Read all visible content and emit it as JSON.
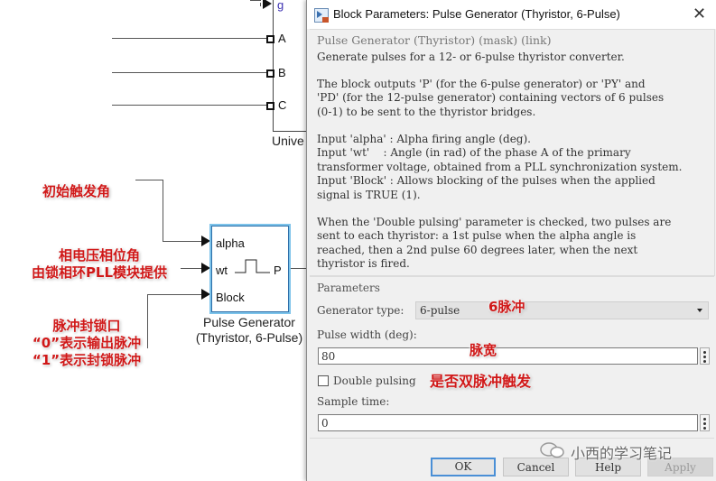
{
  "canvas": {
    "universal_bridge": {
      "ports": [
        "g",
        "A",
        "B",
        "C"
      ],
      "caption_partial": "Unive"
    },
    "pulse_generator": {
      "inputs": [
        "alpha",
        "wt",
        "Block"
      ],
      "output": "P",
      "caption_line1": "Pulse Generator",
      "caption_line2": "(Thyristor, 6-Pulse)"
    },
    "annotations": {
      "alpha": "初始触发角",
      "wt_line1": "相电压相位角",
      "wt_line2": "由锁相环PLL模块提供",
      "block_line1": "脉冲封锁口",
      "block_line2": "“0”表示输出脉冲",
      "block_line3": "“1”表示封锁脉冲",
      "generator_type": "6脉冲",
      "pulse_width": "脉宽",
      "double_pulsing": "是否双脉冲触发"
    },
    "colors": {
      "annotation_red": "#d01818",
      "selected_block_border": "#7cc3ea",
      "port_g_label": "#3a2fb0"
    }
  },
  "dialog": {
    "title": "Block Parameters: Pulse Generator (Thyristor, 6-Pulse)",
    "description_title": "Pulse Generator (Thyristor) (mask) (link)",
    "description": [
      "Generate pulses for a 12- or 6-pulse thyristor converter.",
      "The block outputs 'P' (for the 6-pulse generator) or 'PY' and\n'PD' (for the 12-pulse generator) containing vectors of 6 pulses\n(0-1) to be sent to the thyristor bridges.",
      "Input 'alpha' : Alpha firing angle (deg).\nInput 'wt'    : Angle (in rad) of the phase A of the primary\ntransformer voltage, obtained from a PLL synchronization system.\nInput 'Block' : Allows blocking of the pulses when the applied\nsignal is TRUE (1).",
      "When the 'Double pulsing' parameter is checked, two pulses are\nsent to each thyristor: a 1st pulse when the alpha angle is\nreached, then a 2nd pulse 60 degrees later, when the next\nthyristor is fired."
    ],
    "parameters_title": "Parameters",
    "generator_type": {
      "label": "Generator type:",
      "value": "6-pulse"
    },
    "pulse_width": {
      "label": "Pulse width (deg):",
      "value": "80"
    },
    "double_pulsing": {
      "label": "Double pulsing",
      "checked": false
    },
    "sample_time": {
      "label": "Sample time:",
      "value": "0"
    },
    "buttons": {
      "ok": "OK",
      "cancel": "Cancel",
      "help": "Help",
      "apply": "Apply"
    }
  },
  "watermark": "小西的学习笔记"
}
